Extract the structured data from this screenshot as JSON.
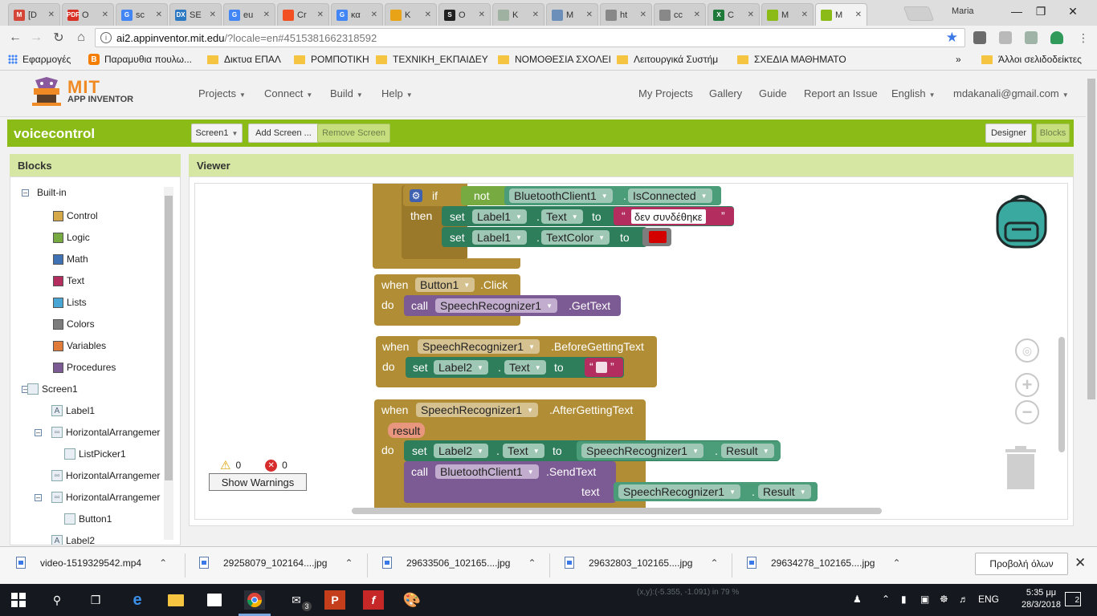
{
  "browser": {
    "tabs": [
      {
        "label": "[D",
        "icon": "gmail-icon",
        "color": "#d44638",
        "glyph": "M"
      },
      {
        "label": "O",
        "icon": "pdf-icon",
        "color": "#d93025",
        "glyph": "PDF"
      },
      {
        "label": "sc",
        "icon": "google-icon",
        "color": "#4285f4",
        "glyph": "G"
      },
      {
        "label": "SE",
        "icon": "dx-icon",
        "color": "#2b79c2",
        "glyph": "DX"
      },
      {
        "label": "eu",
        "icon": "google-icon",
        "color": "#4285f4",
        "glyph": "G"
      },
      {
        "label": "Cr",
        "icon": "microsoft-icon",
        "color": "#f25022",
        "glyph": ""
      },
      {
        "label": "κα",
        "icon": "google-icon",
        "color": "#4285f4",
        "glyph": "G"
      },
      {
        "label": "K",
        "icon": "chart-icon",
        "color": "#e8a317",
        "glyph": ""
      },
      {
        "label": "O",
        "icon": "s-icon",
        "color": "#222222",
        "glyph": "S"
      },
      {
        "label": "K",
        "icon": "leaf-icon",
        "color": "#9fb1a0",
        "glyph": ""
      },
      {
        "label": "M",
        "icon": "search-icon",
        "color": "#6b8fb8",
        "glyph": ""
      },
      {
        "label": "ht",
        "icon": "page-icon",
        "color": "#888888",
        "glyph": ""
      },
      {
        "label": "cc",
        "icon": "page-icon",
        "color": "#888888",
        "glyph": ""
      },
      {
        "label": "C",
        "icon": "x-icon",
        "color": "#1f7a3a",
        "glyph": "X"
      },
      {
        "label": "M",
        "icon": "appinventor-icon",
        "color": "#8bbb16",
        "glyph": ""
      },
      {
        "label": "M",
        "icon": "appinventor-icon",
        "color": "#8bbb16",
        "glyph": ""
      }
    ],
    "user": "Maria",
    "url_host": "ai2.appinventor.mit.edu",
    "url_path": "/?locale=en#4515381662318592",
    "bookmarks": [
      {
        "label": "Εφαρμογές",
        "icon": "apps-icon"
      },
      {
        "label": "Παραμυθια πουλω...",
        "icon": "blogger-icon"
      },
      {
        "label": "Δικτυα ΕΠΑΛ",
        "icon": "folder-icon"
      },
      {
        "label": "ΡΟΜΠΟΤΙΚΗ",
        "icon": "folder-icon"
      },
      {
        "label": "ΤΕΧΝΙΚΗ_ΕΚΠΑΙΔΕΥΣ",
        "icon": "folder-icon"
      },
      {
        "label": "ΝΟΜΟΘΕΣΙΑ ΣΧΟΛΕΙ",
        "icon": "folder-icon"
      },
      {
        "label": "Λειτουργικά Συστήμ",
        "icon": "folder-icon"
      },
      {
        "label": "ΣΧΕΔΙΑ ΜΑΘΗΜΑΤΟ",
        "icon": "folder-icon"
      }
    ],
    "more_bookmarks": "»",
    "other_bookmarks": "Άλλοι σελιδοδείκτες"
  },
  "appinventor": {
    "logo_mit": "MIT",
    "logo_sub": "APP INVENTOR",
    "menu_left": [
      "Projects",
      "Connect",
      "Build",
      "Help"
    ],
    "menu_right": [
      "My Projects",
      "Gallery",
      "Guide",
      "Report an Issue",
      "English",
      "mdakanali@gmail.com"
    ],
    "project_name": "voicecontrol",
    "screen_select": "Screen1",
    "add_screen": "Add Screen ...",
    "remove_screen": "Remove Screen",
    "designer": "Designer",
    "blocks": "Blocks",
    "panel_blocks": "Blocks",
    "panel_viewer": "Viewer",
    "builtin_label": "Built-in",
    "builtin": [
      {
        "label": "Control",
        "color": "#d5a84a"
      },
      {
        "label": "Logic",
        "color": "#77ab41"
      },
      {
        "label": "Math",
        "color": "#3f71b5"
      },
      {
        "label": "Text",
        "color": "#b32d5e"
      },
      {
        "label": "Lists",
        "color": "#49a6d4"
      },
      {
        "label": "Colors",
        "color": "#7d7d7d"
      },
      {
        "label": "Variables",
        "color": "#e07b39"
      },
      {
        "label": "Procedures",
        "color": "#7c5a93"
      }
    ],
    "components": [
      {
        "label": "Screen1",
        "level": 0
      },
      {
        "label": "Label1",
        "level": 1
      },
      {
        "label": "HorizontalArrangemer",
        "level": 1
      },
      {
        "label": "ListPicker1",
        "level": 2
      },
      {
        "label": "HorizontalArrangemer",
        "level": 1
      },
      {
        "label": "HorizontalArrangemer",
        "level": 1
      },
      {
        "label": "Button1",
        "level": 2
      },
      {
        "label": "Label2",
        "level": 1
      }
    ],
    "warnings_count": "0",
    "errors_count": "0",
    "show_warnings": "Show Warnings"
  },
  "workspace": {
    "b1": {
      "if": "if",
      "not": "not",
      "comp": "BluetoothClient1",
      "prop": "IsConnected",
      "then": "then",
      "set": "set",
      "label1": "Label1",
      "text_prop": "Text",
      "to": "to",
      "str": "δεν συνδέθηκε",
      "textcolor_prop": "TextColor",
      "color_red": "#d40000"
    },
    "b2": {
      "when": "when",
      "comp": "Button1",
      "event": ".Click",
      "do": "do",
      "call": "call",
      "target": "SpeechRecognizer1",
      "method": ".GetText"
    },
    "b3": {
      "when": "when",
      "comp": "SpeechRecognizer1",
      "event": ".BeforeGettingText",
      "do": "do",
      "set": "set",
      "label": "Label2",
      "prop": "Text",
      "to": "to"
    },
    "b4": {
      "when": "when",
      "comp": "SpeechRecognizer1",
      "event": ".AfterGettingText",
      "param": "result",
      "do": "do",
      "set": "set",
      "label": "Label2",
      "prop": "Text",
      "to": "to",
      "src": "SpeechRecognizer1",
      "src_prop": "Result",
      "call": "call",
      "bt": "BluetoothClient1",
      "method": ".SendText",
      "arg": "text",
      "arg_src": "SpeechRecognizer1",
      "arg_prop": "Result"
    },
    "dot": ".",
    "quote_open": "“",
    "quote_close": "”"
  },
  "downloads": {
    "items": [
      "video-1519329542.mp4",
      "29258079_102164....jpg",
      "29633506_102165....jpg",
      "29632803_102165....jpg",
      "29634278_102165....jpg"
    ],
    "show_all": "Προβολή όλων"
  },
  "taskbar": {
    "lang": "ENG",
    "time": "5:35 μμ",
    "date": "28/3/2018",
    "notifications": "2",
    "mail_badge": "3",
    "ghost": "(x,y):(-5.355, -1.091) in      79 %"
  }
}
